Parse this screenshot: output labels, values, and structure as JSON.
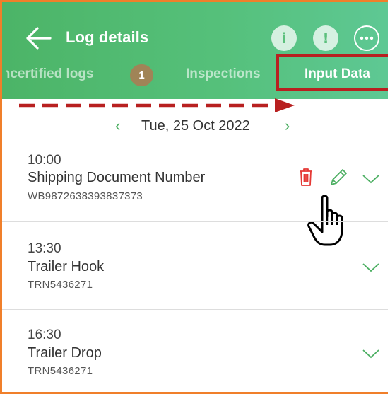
{
  "header": {
    "title": "Log details",
    "info_glyph": "i",
    "alert_glyph": "!",
    "icons": [
      "back-arrow-icon",
      "info-icon",
      "alert-icon",
      "more-options-icon"
    ]
  },
  "tabs": [
    {
      "label": "Uncertified logs",
      "badge": "1",
      "active": false
    },
    {
      "label": "Inspections",
      "active": false
    },
    {
      "label": "Input Data",
      "active": true
    }
  ],
  "date": {
    "label": "Tue, 25 Oct 2022",
    "prev_glyph": "‹",
    "next_glyph": "›"
  },
  "entries": [
    {
      "time": "10:00",
      "title": "Shipping Document Number",
      "value": "WB9872638393837373",
      "actions": [
        "delete-icon",
        "edit-icon",
        "chevron-down-icon"
      ]
    },
    {
      "time": "13:30",
      "title": "Trailer Hook",
      "value": "TRN5436271",
      "actions": [
        "chevron-down-icon"
      ]
    },
    {
      "time": "16:30",
      "title": "Trailer Drop",
      "value": "TRN5436271",
      "actions": [
        "chevron-down-icon"
      ]
    }
  ],
  "colors": {
    "header_green": "#55c07a",
    "accent_green": "#4caf62",
    "badge_brown": "#a08457",
    "delete_red": "#e53935",
    "annotation_red": "#b82020",
    "frame_orange": "#f07f2a"
  }
}
